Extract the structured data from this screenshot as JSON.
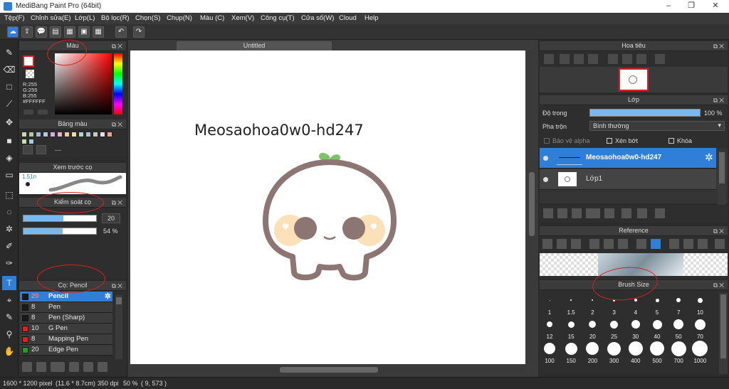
{
  "window": {
    "title": "MediBang Paint Pro (64bit)",
    "minimize": "–",
    "maximize": "❐",
    "close": "✕"
  },
  "menu": [
    "Tệp(F)",
    "Chỉnh sửa(E)",
    "Lớp(L)",
    "Bộ lọc(R)",
    "Chọn(S)",
    "Chụp(N)",
    "Màu (C)",
    "Xem(V)",
    "Công cụ(T)",
    "Cửa sổ(W)",
    "Cloud",
    "Help"
  ],
  "toolbar_icons": [
    "cloud-icon",
    "share-icon",
    "chat-icon",
    "comment-icon",
    "page-icon",
    "grid-page-icon",
    "grid-icon",
    "undo-icon",
    "redo-icon"
  ],
  "color_panel": {
    "title": "Màu",
    "rgb_r": "R:255",
    "rgb_g": "G:255",
    "rgb_b": "B:255",
    "hex": "#FFFFFF",
    "fg_color": "#ff0000",
    "bg_color": "#ffffff"
  },
  "palette_panel": {
    "title": "Bảng màu",
    "dashes": "---",
    "swatches": [
      "#c8d8b0",
      "#b0c8a0",
      "#a0b8d0",
      "#c0c0e8",
      "#d0b0e0",
      "#e8b0c0",
      "#f0c8a0",
      "#e8e0a0",
      "#a8d8d0",
      "#b0c0d8",
      "#c8c8c8",
      "#e0e0e0",
      "#f4a090",
      "#c8e0a8",
      "#a0d0e8"
    ]
  },
  "brush_preview": {
    "title": "Xem trước cọ",
    "size": "1.51n"
  },
  "brush_control": {
    "title": "Kiểm soát cọ",
    "size_value": "20",
    "opacity_value": "54 %",
    "size_fraction": 0.55,
    "opacity_fraction": 0.54
  },
  "brush_list": {
    "title": "Cọ: Pencil",
    "items": [
      {
        "size": "20",
        "name": "Pencil",
        "color": "#1a1a1a",
        "selected": true
      },
      {
        "size": "8",
        "name": "Pen",
        "color": "#1a1a1a"
      },
      {
        "size": "8",
        "name": "Pen (Sharp)",
        "color": "#1a1a1a"
      },
      {
        "size": "10",
        "name": "G Pen",
        "color": "#e02020"
      },
      {
        "size": "8",
        "name": "Mapping Pen",
        "color": "#e02020"
      },
      {
        "size": "20",
        "name": "Edge Pen",
        "color": "#20a020"
      }
    ]
  },
  "document": {
    "tab": "Untitled",
    "canvas_text": "Meosaohoa0w0-hd247"
  },
  "navigator": {
    "title": "Hoa tiêu"
  },
  "layer_panel": {
    "title": "Lớp",
    "opacity_label": "Độ trong",
    "opacity_value": "100 %",
    "opacity_fraction": 1.0,
    "blend_label": "Pha trộn",
    "blend_value": "Bình thường",
    "protect_alpha": "Bảo vệ alpha",
    "clipping": "Xén bớt",
    "lock": "Khóa",
    "layers": [
      {
        "name": "Meosaohoa0w0-hd247",
        "selected": true
      },
      {
        "name": "Lớp1",
        "selected": false
      }
    ]
  },
  "reference": {
    "title": "Reference"
  },
  "brush_size": {
    "title": "Brush Size",
    "sizes": [
      "1",
      "1.5",
      "2",
      "3",
      "4",
      "5",
      "7",
      "10",
      "12",
      "15",
      "20",
      "25",
      "30",
      "40",
      "50",
      "70",
      "100",
      "150",
      "200",
      "300",
      "400",
      "500",
      "700",
      "1000"
    ]
  },
  "status": {
    "dimensions": "1600 * 1200 pixel",
    "physical": "(11.6 * 8.7cm)",
    "dpi": "350 dpi",
    "zoom": "50 %",
    "coords": "( 9, 573 )"
  }
}
